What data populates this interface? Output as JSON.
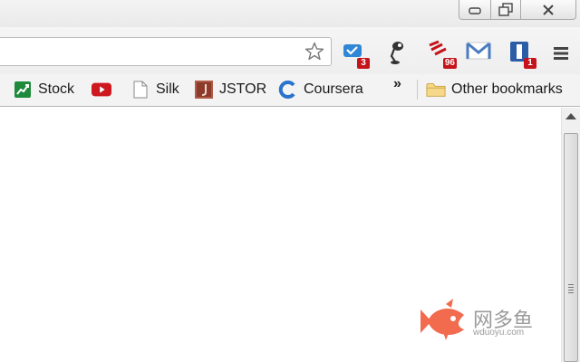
{
  "window_controls": {
    "minimize": "minimize-icon",
    "restore": "restore-icon",
    "close": "close-icon"
  },
  "toolbar": {
    "address_value": "",
    "bookmark_star": "star-icon",
    "extensions": [
      {
        "name": "mail-checker-icon",
        "badge": "3",
        "color": "#2f87d6"
      },
      {
        "name": "lamp-icon",
        "badge": "",
        "color": "#333333"
      },
      {
        "name": "feed-reader-icon",
        "badge": "96",
        "color": "#c4131b"
      },
      {
        "name": "gmail-icon",
        "badge": "",
        "color": "#4a7cc2"
      },
      {
        "name": "notifier-icon",
        "badge": "1",
        "color": "#2c5ea8"
      }
    ],
    "menu": "menu-icon"
  },
  "bookmarks": {
    "items": [
      {
        "label": "Stock",
        "icon": "stock-chart-icon",
        "color": "#1f8a3c"
      },
      {
        "label": "",
        "icon": "youtube-icon",
        "color": "#cc181e"
      },
      {
        "label": "Silk",
        "icon": "page-icon",
        "color": "#9a9a9a"
      },
      {
        "label": "JSTOR",
        "icon": "jstor-icon",
        "color": "#8b3a2b"
      },
      {
        "label": "Coursera",
        "icon": "coursera-icon",
        "color": "#2a73cc"
      }
    ],
    "overflow_label": "»",
    "other_label": "Other bookmarks"
  },
  "watermark": {
    "title": "网多鱼",
    "url": "wduoyu.com",
    "color": "#f26b4f"
  }
}
